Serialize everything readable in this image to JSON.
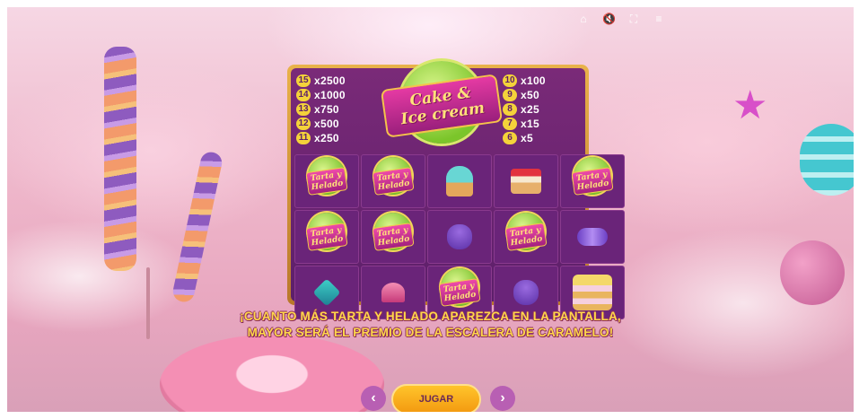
{
  "topbar": {
    "icons": [
      "home-icon",
      "sound-off-icon",
      "fullscreen-icon",
      "menu-icon"
    ]
  },
  "logo": {
    "line1": "Cake &",
    "line2": "Ice cream"
  },
  "paytable": {
    "left": [
      {
        "num": "15",
        "mult": "x2500"
      },
      {
        "num": "14",
        "mult": "x1000"
      },
      {
        "num": "13",
        "mult": "x750"
      },
      {
        "num": "12",
        "mult": "x500"
      },
      {
        "num": "11",
        "mult": "x250"
      }
    ],
    "right": [
      {
        "num": "10",
        "mult": "x100"
      },
      {
        "num": "9",
        "mult": "x50"
      },
      {
        "num": "8",
        "mult": "x25"
      },
      {
        "num": "7",
        "mult": "x15"
      },
      {
        "num": "6",
        "mult": "x5"
      }
    ]
  },
  "wild": {
    "line1": "Tarta y",
    "line2": "Helado"
  },
  "grid": [
    [
      "wild",
      "wild",
      "cupcake",
      "cakeslice",
      "wild"
    ],
    [
      "wild",
      "wild",
      "club",
      "wild",
      "candy"
    ],
    [
      "diamond",
      "heart",
      "wild",
      "club",
      "bigcake"
    ]
  ],
  "caption": {
    "line1": "¡CUANTO MÁS TARTA Y HELADO APAREZCA EN LA PANTALLA,",
    "line2": "MAYOR SERÁ EL PREMIO DE LA ESCALERA DE CARAMELO!"
  },
  "controls": {
    "prev": "‹",
    "next": "›",
    "play_label": "JUGAR"
  },
  "colors": {
    "accent": "#ffd84a",
    "panel": "#5c1f6a",
    "play": "#f9b11f"
  }
}
